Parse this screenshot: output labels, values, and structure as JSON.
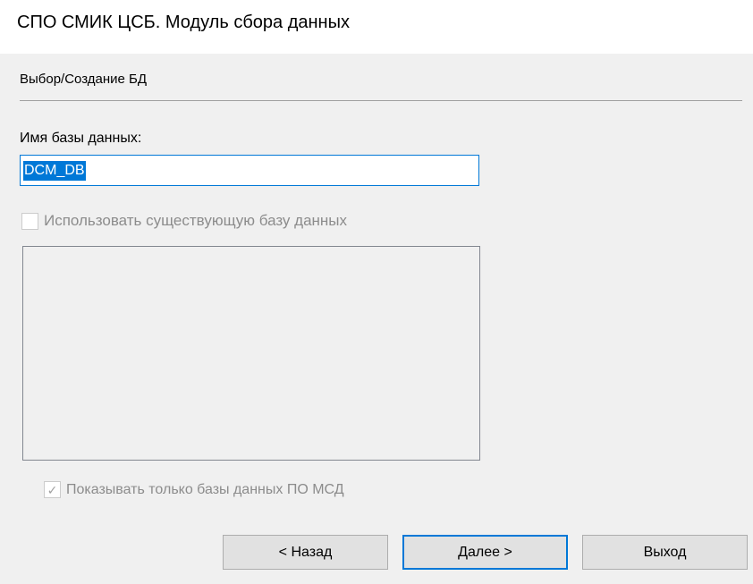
{
  "window": {
    "title": "СПО СМИК ЦСБ. Модуль сбора данных"
  },
  "section": {
    "title": "Выбор/Создание БД"
  },
  "db_name": {
    "label": "Имя базы данных:",
    "value": "DCM_DB"
  },
  "use_existing": {
    "label": "Использовать существующую базу данных",
    "checked": false,
    "enabled": false
  },
  "db_list": {
    "items": []
  },
  "only_msd": {
    "label": "Показывать только базы данных ПО МСД",
    "checked": true,
    "enabled": false,
    "check_glyph": "✓"
  },
  "buttons": {
    "back": "< Назад",
    "next": "Далее >",
    "exit": "Выход"
  },
  "colors": {
    "accent": "#0078d7",
    "dialog_bg": "#f0f0f0",
    "disabled_text": "#8c8c8c"
  }
}
